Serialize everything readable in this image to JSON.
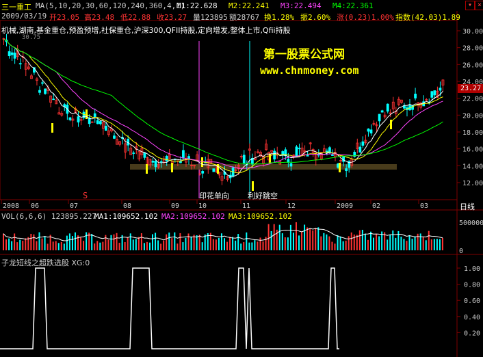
{
  "stock": {
    "name": "三一重工",
    "ma_params": "MA(5,10,20,30,60,120,240,360,4,1)",
    "m1": "M1:22.628",
    "m2": "M2:22.241",
    "m3": "M3:22.494",
    "m4": "M4:22.361",
    "date": "2009/03/19",
    "open": "开23.05",
    "high": "高23.48",
    "low": "低22.88",
    "close": "收23.27",
    "volume": "量123895",
    "amount": "额28767",
    "turnover": "换1.28%",
    "amplitude": "振2.60%",
    "change": "涨(0.23)1.00%",
    "index": "指数(42.03)1.89",
    "concepts": "机械,湖南,基金重仓,预盈预增,社保重仓,沪深300,QFII持股,定向增发,整体上市,Qfii持股",
    "watermark_cn": "第一股票公式网",
    "watermark_url": "www.chnmoney.com",
    "current_price": "23.27",
    "low_price_tag": "30.75",
    "annotation_1": "印花单向",
    "annotation_2": "利好跳空",
    "signal_s": "S"
  },
  "price_axis": [
    "30.00",
    "28.00",
    "26.00",
    "24.00",
    "22.00",
    "20.00",
    "18.00",
    "16.00",
    "14.00",
    "12.00"
  ],
  "time_axis": {
    "labels": [
      "2008",
      "06",
      "07",
      "08",
      "09",
      "10",
      "11",
      "12",
      "2009",
      "02",
      "03"
    ],
    "unit_label": "日线"
  },
  "volume_panel": {
    "label": "VOL(6,6,6) 123895.227",
    "ma1": "MA1:109652.102",
    "ma2": "MA2:109652.102",
    "ma3": "MA3:109652.102",
    "axis": [
      "500000",
      "0"
    ]
  },
  "indicator_panel": {
    "label": "子龙短线之超跌选股 XG:0",
    "axis": [
      "1.00",
      "0.80",
      "0.60",
      "0.40",
      "0.20"
    ]
  },
  "colors": {
    "up": "#ff3333",
    "down": "#00ffff",
    "ma_white": "#ffffff",
    "ma_yellow": "#ffff00",
    "ma_magenta": "#ff44ff",
    "ma_green": "#00ff00",
    "watermark": "#ffff00"
  },
  "chart_data": {
    "type": "line",
    "title": "三一重工",
    "xlabel": "",
    "ylabel": "",
    "ylim": [
      11,
      31
    ],
    "x": [
      "2008",
      "06",
      "07",
      "08",
      "09",
      "10",
      "11",
      "12",
      "2009",
      "02",
      "03"
    ],
    "series": [
      {
        "name": "M1",
        "values": [
          29.0,
          24.5,
          20.0,
          19.5,
          16.0,
          14.5,
          14.8,
          12.5,
          15.5,
          15.0,
          16.0,
          14.5,
          20.0,
          21.5,
          23.0
        ]
      }
    ]
  }
}
